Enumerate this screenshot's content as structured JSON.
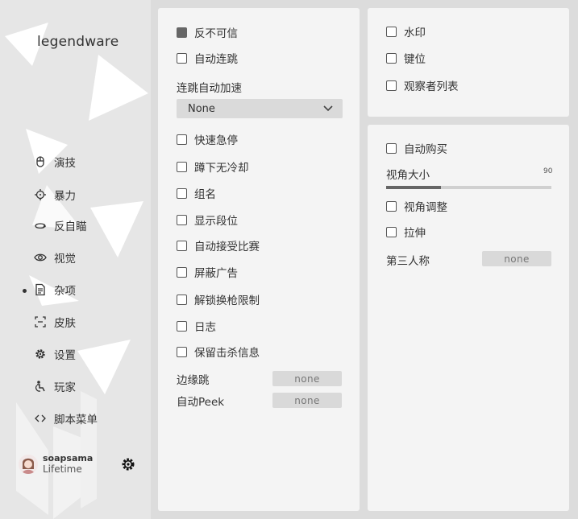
{
  "brand": {
    "title": "legendware"
  },
  "sidebar": {
    "items": [
      {
        "label": "演技",
        "icon": "mouse-icon"
      },
      {
        "label": "暴力",
        "icon": "crosshair-icon"
      },
      {
        "label": "反自瞄",
        "icon": "rotate-icon"
      },
      {
        "label": "视觉",
        "icon": "eye-icon"
      },
      {
        "label": "杂项",
        "icon": "document-icon",
        "active": true
      },
      {
        "label": "皮肤",
        "icon": "scan-frame-icon"
      },
      {
        "label": "设置",
        "icon": "gear-icon"
      },
      {
        "label": "玩家",
        "icon": "player-icon"
      },
      {
        "label": "脚本菜单",
        "icon": "code-icon"
      }
    ]
  },
  "user": {
    "name": "soapsama",
    "subscription": "Lifetime"
  },
  "panel_main": {
    "anti_untrusted": "反不可信",
    "auto_bhop": "自动连跳",
    "autojump_speed_label": "连跳自动加速",
    "autojump_speed_value": "None",
    "fast_stop": "快速急停",
    "duck_no_cooldown": "蹲下无冷却",
    "clantag": "组名",
    "show_rank": "显示段位",
    "auto_accept": "自动接受比赛",
    "block_ads": "屏蔽广告",
    "unlock_weapon_limit": "解锁换枪限制",
    "log": "日志",
    "preserve_killfeed": "保留击杀信息",
    "edge_jump_label": "边缘跳",
    "edge_jump_key": "none",
    "auto_peek_label": "自动Peek",
    "auto_peek_key": "none"
  },
  "panel_top": {
    "watermark": "水印",
    "keybinds": "键位",
    "spectator_list": "观察者列表"
  },
  "panel_bottom": {
    "auto_buy": "自动购买",
    "fov_label": "视角大小",
    "fov_value": "90",
    "fov_fill": 0.33,
    "fov_adjust": "视角调整",
    "stretch": "拉伸",
    "third_person_label": "第三人称",
    "third_person_key": "none"
  },
  "colors": {
    "accent": "#666666",
    "panel": "#f4f4f4",
    "sidebar": "#e6e6e6"
  }
}
